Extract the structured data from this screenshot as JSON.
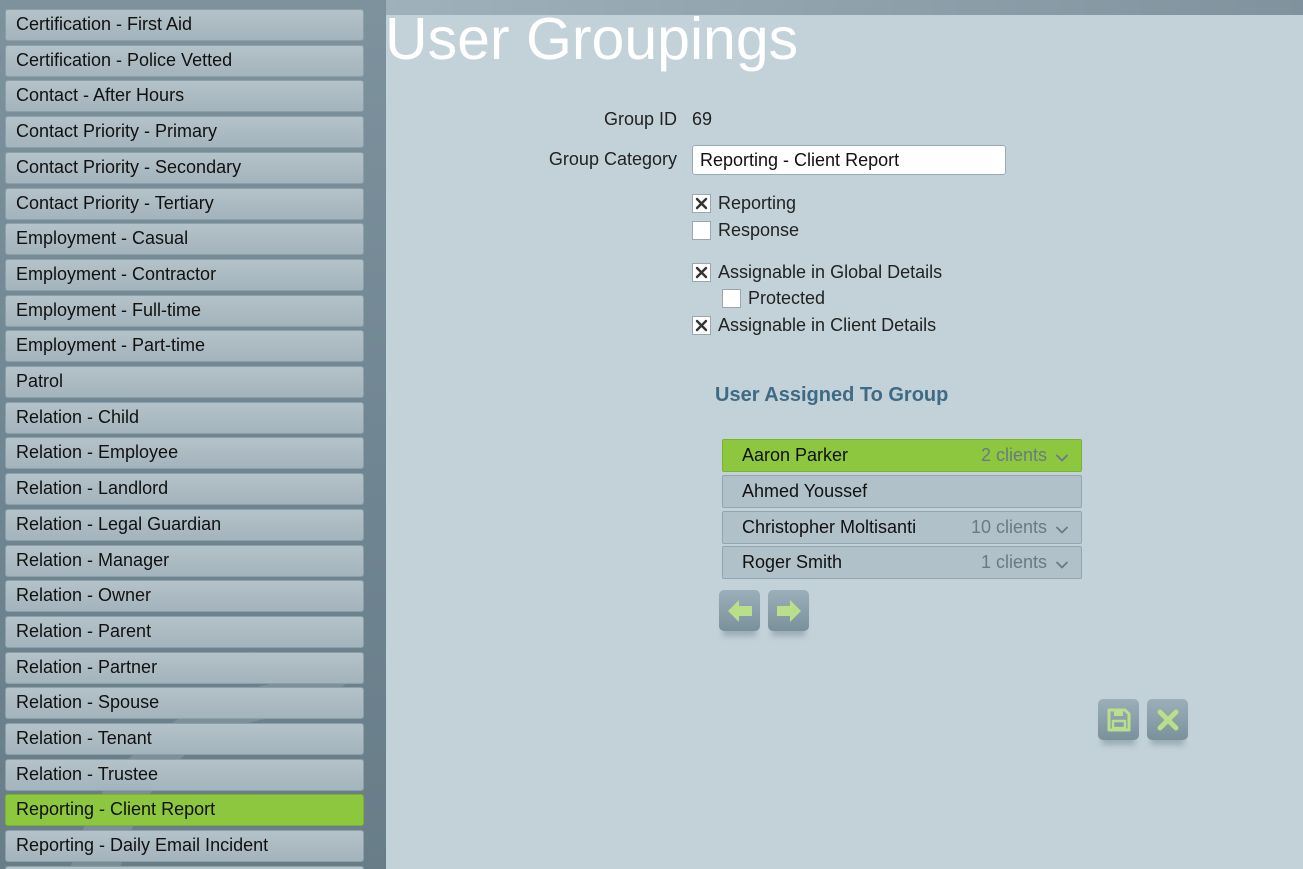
{
  "sidebar": {
    "items": [
      {
        "label": "Certification - First Aid",
        "active": false
      },
      {
        "label": "Certification - Police Vetted",
        "active": false
      },
      {
        "label": "Contact - After Hours",
        "active": false
      },
      {
        "label": "Contact Priority - Primary",
        "active": false
      },
      {
        "label": "Contact Priority - Secondary",
        "active": false
      },
      {
        "label": "Contact Priority - Tertiary",
        "active": false
      },
      {
        "label": "Employment - Casual",
        "active": false
      },
      {
        "label": "Employment - Contractor",
        "active": false
      },
      {
        "label": "Employment - Full-time",
        "active": false
      },
      {
        "label": "Employment - Part-time",
        "active": false
      },
      {
        "label": "Patrol",
        "active": false
      },
      {
        "label": "Relation - Child",
        "active": false
      },
      {
        "label": "Relation - Employee",
        "active": false
      },
      {
        "label": "Relation - Landlord",
        "active": false
      },
      {
        "label": "Relation - Legal Guardian",
        "active": false
      },
      {
        "label": "Relation - Manager",
        "active": false
      },
      {
        "label": "Relation - Owner",
        "active": false
      },
      {
        "label": "Relation - Parent",
        "active": false
      },
      {
        "label": "Relation - Partner",
        "active": false
      },
      {
        "label": "Relation - Spouse",
        "active": false
      },
      {
        "label": "Relation - Tenant",
        "active": false
      },
      {
        "label": "Relation - Trustee",
        "active": false
      },
      {
        "label": "Reporting - Client Report",
        "active": true
      },
      {
        "label": "Reporting - Daily Email Incident",
        "active": false
      }
    ]
  },
  "page": {
    "title": "User Groupings"
  },
  "form": {
    "group_id_label": "Group ID",
    "group_id_value": "69",
    "group_category_label": "Group Category",
    "group_category_value": "Reporting - Client Report",
    "checkboxes": {
      "reporting": {
        "label": "Reporting",
        "checked": true
      },
      "response": {
        "label": "Response",
        "checked": false
      },
      "assignable_global": {
        "label": "Assignable in Global Details",
        "checked": true
      },
      "protected": {
        "label": "Protected",
        "checked": false
      },
      "assignable_client": {
        "label": "Assignable in Client Details",
        "checked": true
      }
    }
  },
  "assigned": {
    "heading": "User Assigned To Group",
    "users": [
      {
        "name": "Aaron Parker",
        "count": "2 clients",
        "active": true,
        "expandable": true
      },
      {
        "name": "Ahmed Youssef",
        "count": "",
        "active": false,
        "expandable": false
      },
      {
        "name": "Christopher Moltisanti",
        "count": "10 clients",
        "active": false,
        "expandable": true
      },
      {
        "name": "Roger Smith",
        "count": "1 clients",
        "active": false,
        "expandable": true
      }
    ]
  },
  "icons": {
    "move_left": "arrow-left-icon",
    "move_right": "arrow-right-icon",
    "save": "floppy-disk-icon",
    "cancel": "close-icon",
    "expand": "chevron-down-icon"
  },
  "colors": {
    "accent_green": "#8dc63f",
    "icon_green": "#b9df8a",
    "heading_blue": "#3f6a86",
    "background": "#c3d2d9"
  }
}
